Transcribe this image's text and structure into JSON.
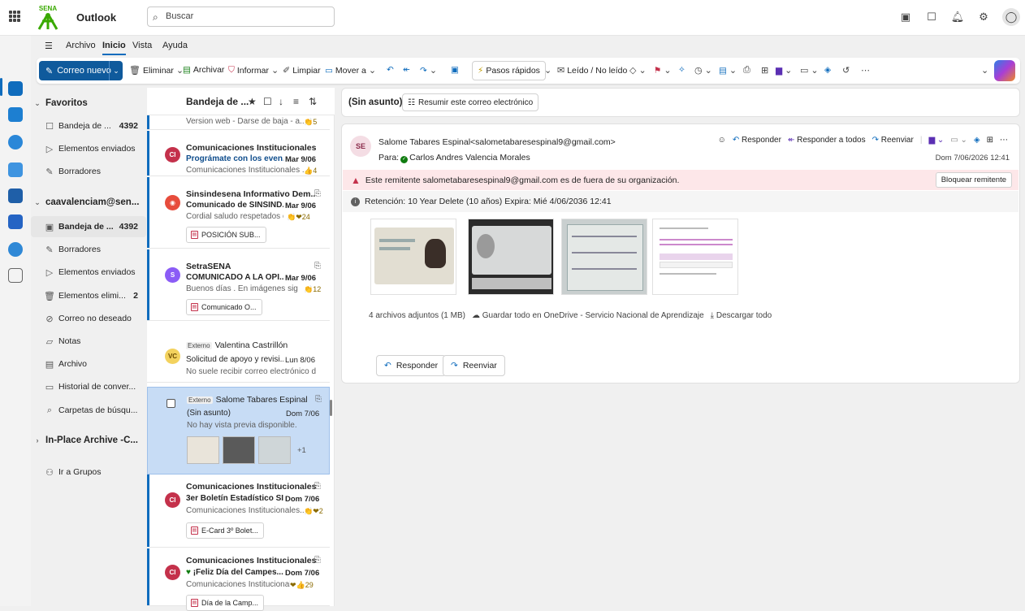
{
  "app": {
    "name": "Outlook",
    "logo_text": "SENA"
  },
  "search": {
    "placeholder": "Buscar"
  },
  "menu": {
    "items": [
      "Archivo",
      "Inicio",
      "Vista",
      "Ayuda"
    ]
  },
  "ribbon": {
    "new_mail": "Correo nuevo",
    "delete": "Eliminar",
    "archive": "Archivar",
    "report": "Informar",
    "clean": "Limpiar",
    "move": "Mover a",
    "quick_steps": "Pasos rápidos",
    "read_unread": "Leído / No leído"
  },
  "nav": {
    "favorites": "Favoritos",
    "fav_inbox": "Bandeja de ...",
    "fav_inbox_count": "4392",
    "fav_sent": "Elementos enviados",
    "fav_drafts": "Borradores",
    "account": "caavalenciam@sen...",
    "inbox": "Bandeja de ...",
    "inbox_count": "4392",
    "drafts": "Borradores",
    "sent": "Elementos enviados",
    "deleted": "Elementos elimi...",
    "deleted_count": "2",
    "junk": "Correo no deseado",
    "notes": "Notas",
    "archive": "Archivo",
    "history": "Historial de conver...",
    "search_folders": "Carpetas de búsqu...",
    "archive_group": "In-Place Archive -C...",
    "groups": "Ir a Grupos"
  },
  "list": {
    "title": "Bandeja de ...",
    "items": [
      {
        "preview": "Version web - Darse de baja - a...",
        "reactions": "5"
      },
      {
        "avatar": "CI",
        "sender": "Comunicaciones Institucionales",
        "subject": "Prográmate con los even...",
        "date": "Mar 9/06",
        "preview": "Comunicaciones Institucionales ...",
        "reactions": "4"
      },
      {
        "sender": "Sinsindesena Informativo Dem...",
        "subject": "Comunicado de SINSIND...",
        "date": "Mar 9/06",
        "preview": "Cordial saludo respetados c...",
        "reactions": "24",
        "attachment": "POSICIÓN SUB..."
      },
      {
        "avatar": "S",
        "sender": "SetraSENA",
        "subject": "COMUNICADO A LA OPI...",
        "date": "Mar 9/06",
        "preview": "Buenos días . En imágenes sig...",
        "reactions": "12",
        "attachment": "Comunicado O..."
      },
      {
        "avatar": "VC",
        "tag": "Externo",
        "sender": "Valentina Castrillón",
        "subject": "Solicitud de apoyo y revisi...",
        "date": "Lun 8/06",
        "preview": "No suele recibir correo electrónico d..."
      },
      {
        "tag": "Externo",
        "sender": "Salome Tabares Espinal",
        "subject": "(Sin asunto)",
        "date": "Dom 7/06",
        "preview": "No hay vista previa disponible.",
        "more": "+1"
      },
      {
        "avatar": "CI",
        "sender": "Comunicaciones Institucionales",
        "subject": "3er Boletín Estadístico SI...",
        "date": "Dom 7/06",
        "preview": "Comunicaciones Institucionales...",
        "reactions": "2",
        "attachment": "E-Card 3º Bolet..."
      },
      {
        "avatar": "CI",
        "sender": "Comunicaciones Institucionales",
        "subject": "¡Feliz Día del Campes...",
        "date": "Dom 7/06",
        "preview": "Comunicaciones Institucional...",
        "reactions": "29",
        "attachment": "Día de la Camp..."
      }
    ]
  },
  "reading": {
    "subject": "(Sin asunto)",
    "summarize": "Resumir este correo electrónico",
    "avatar": "SE",
    "from": "Salome Tabares Espinal<salometabaresespinal9@gmail.com>",
    "to_label": "Para:",
    "to": "Carlos Andres Valencia Morales",
    "reply": "Responder",
    "reply_all": "Responder a todos",
    "forward": "Reenviar",
    "date": "Dom 7/06/2026 12:41",
    "warning": "Este remitente salometabaresespinal9@gmail.com es de fuera de su organización.",
    "block": "Bloquear remitente",
    "retention": "Retención: 10 Year Delete (10 años) Expira: Mié 4/06/2036 12:41",
    "attachments_info": "4 archivos adjuntos (1 MB)",
    "save_onedrive": "Guardar todo en OneDrive - Servicio Nacional de Aprendizaje",
    "download_all": "Descargar todo",
    "btn_reply": "Responder",
    "btn_forward": "Reenviar"
  },
  "colors": {
    "accent": "#0f6cbd",
    "warning_bg": "#fde7e9",
    "selected": "#c7dcf5"
  }
}
